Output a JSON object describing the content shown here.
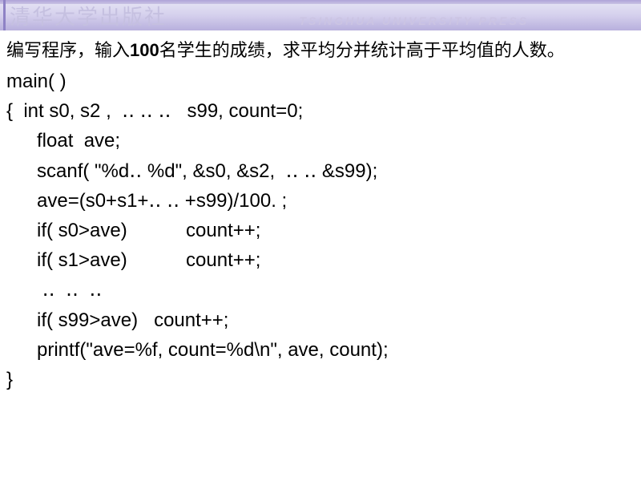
{
  "header": {
    "publisher": "清华大学出版社",
    "university": "TSINGHUA UNIVERSITY PRESS"
  },
  "problem": {
    "pre": "编写程序，输入",
    "bold": "100",
    "post": "名学生的成绩，求平均分并统计高于平均值的人数。"
  },
  "code": {
    "l1": "main( )",
    "l2": "{  int s0, s2 ,  ‥ ‥ ‥   s99, count=0;",
    "l3": "float  ave;",
    "l4": "scanf( \"%d‥ %d\", &s0, &s2,  ‥ ‥ &s99);",
    "l5": "ave=(s0+s1+‥ ‥ +s99)/100. ;",
    "l6": "if( s0>ave)           count++;",
    "l7": "if( s1>ave)           count++;",
    "l8": " ‥  ‥  ‥",
    "l9": "if( s99>ave)   count++;",
    "l10": "printf(\"ave=%f, count=%d\\n\", ave, count);",
    "l11": "}"
  }
}
